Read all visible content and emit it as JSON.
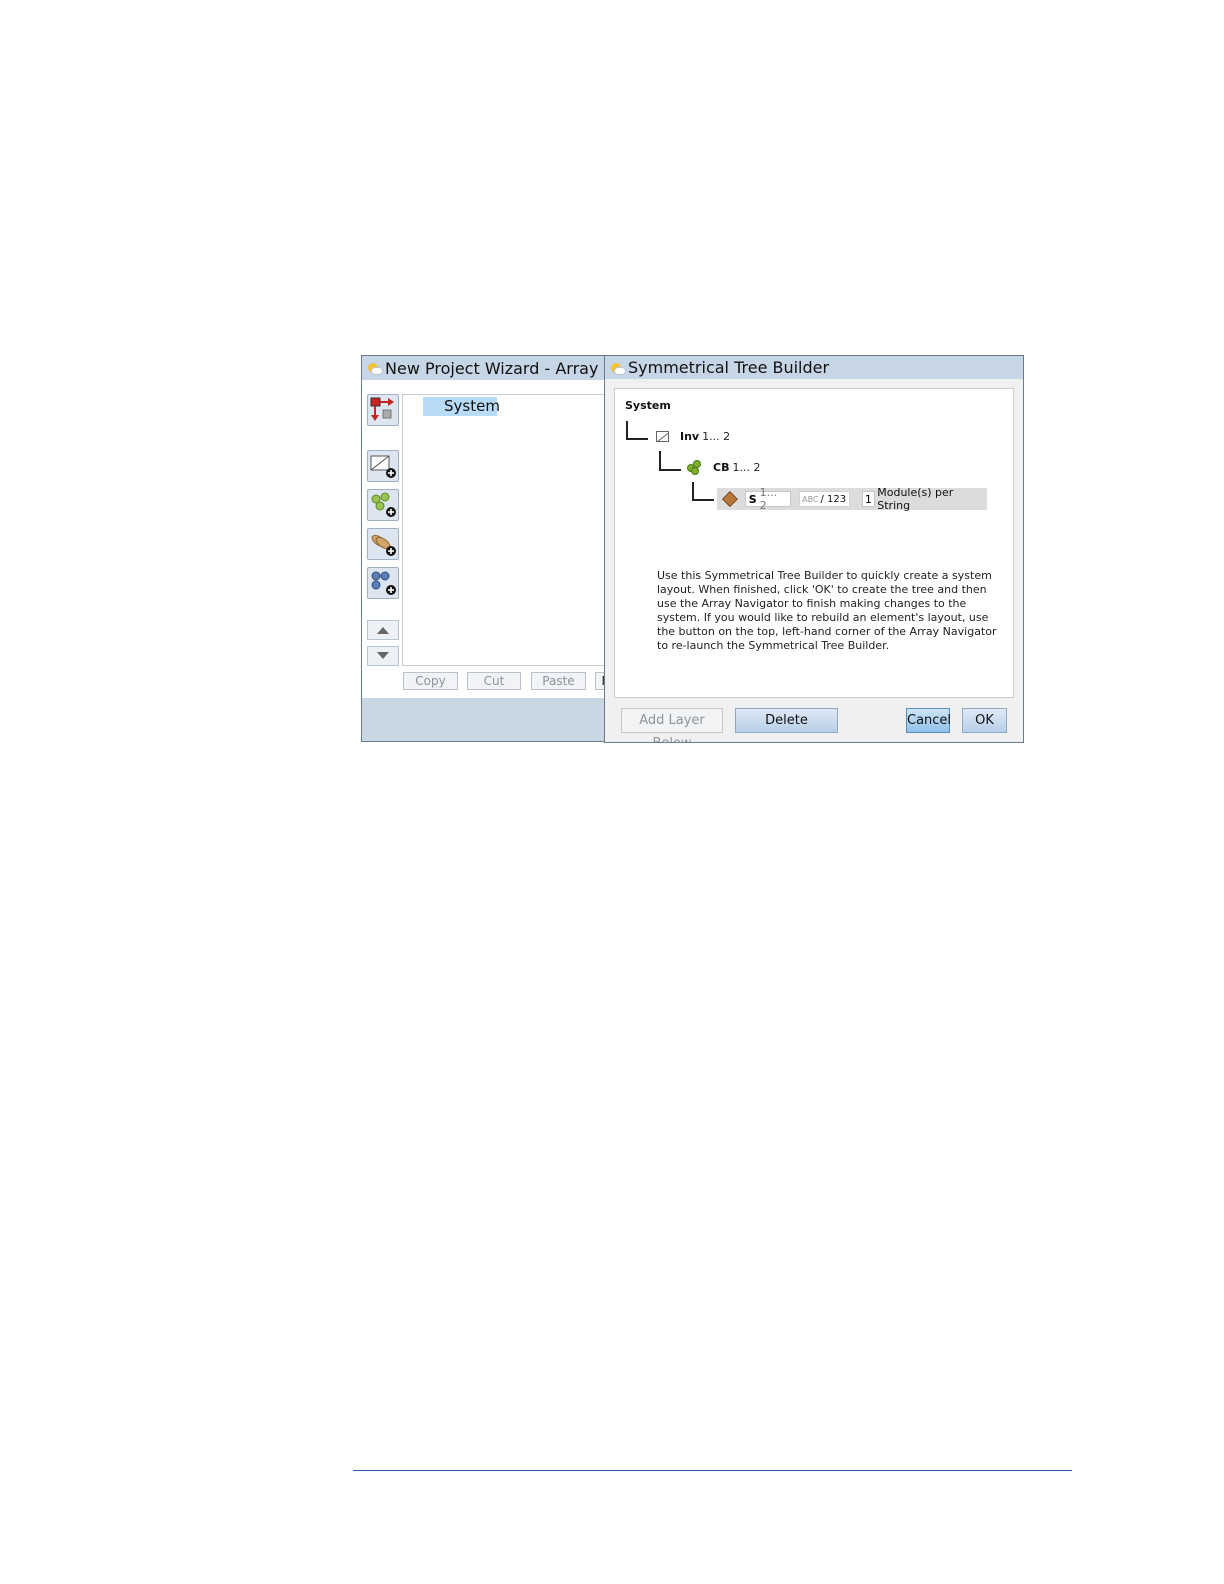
{
  "wizard": {
    "title": "New Project Wizard - Array Na",
    "tree_root": "System",
    "buttons": {
      "copy": "Copy",
      "cut": "Cut",
      "paste": "Paste",
      "truncated": "F"
    },
    "toolbar_icons": [
      "rebuild-tree-icon",
      "add-inverter-icon",
      "add-combiner-icon",
      "add-string-icon",
      "add-modules-icon",
      "move-up-icon",
      "move-down-icon"
    ]
  },
  "dialog": {
    "title": "Symmetrical Tree Builder",
    "root": "System",
    "inv": {
      "label": "Inv",
      "range": "1... 2"
    },
    "cb": {
      "label": "CB",
      "range": "1... 2"
    },
    "string": {
      "label": "S",
      "range": "1... 2",
      "naming_placeholder": "ABC",
      "naming_value": "/ 123",
      "modules_count": "1",
      "modules_label": "Module(s) per String"
    },
    "help_lines": [
      "Use this Symmetrical Tree Builder to quickly create a system",
      "layout. When finished, click 'OK' to create the tree and then",
      "use the Array Navigator to finish making changes to the",
      "system. If you would like to rebuild an element's layout, use",
      "the button on the top, left-hand corner of the Array Navigator",
      "to re-launch the Symmetrical Tree Builder."
    ],
    "buttons": {
      "add_layer": "Add Layer Below",
      "delete": "Delete",
      "cancel": "Cancel",
      "ok": "OK"
    }
  },
  "colors": {
    "title_bar": "#c7d6e6",
    "selection": "#b8dcf7",
    "footer_rule": "#2b5fa8"
  }
}
